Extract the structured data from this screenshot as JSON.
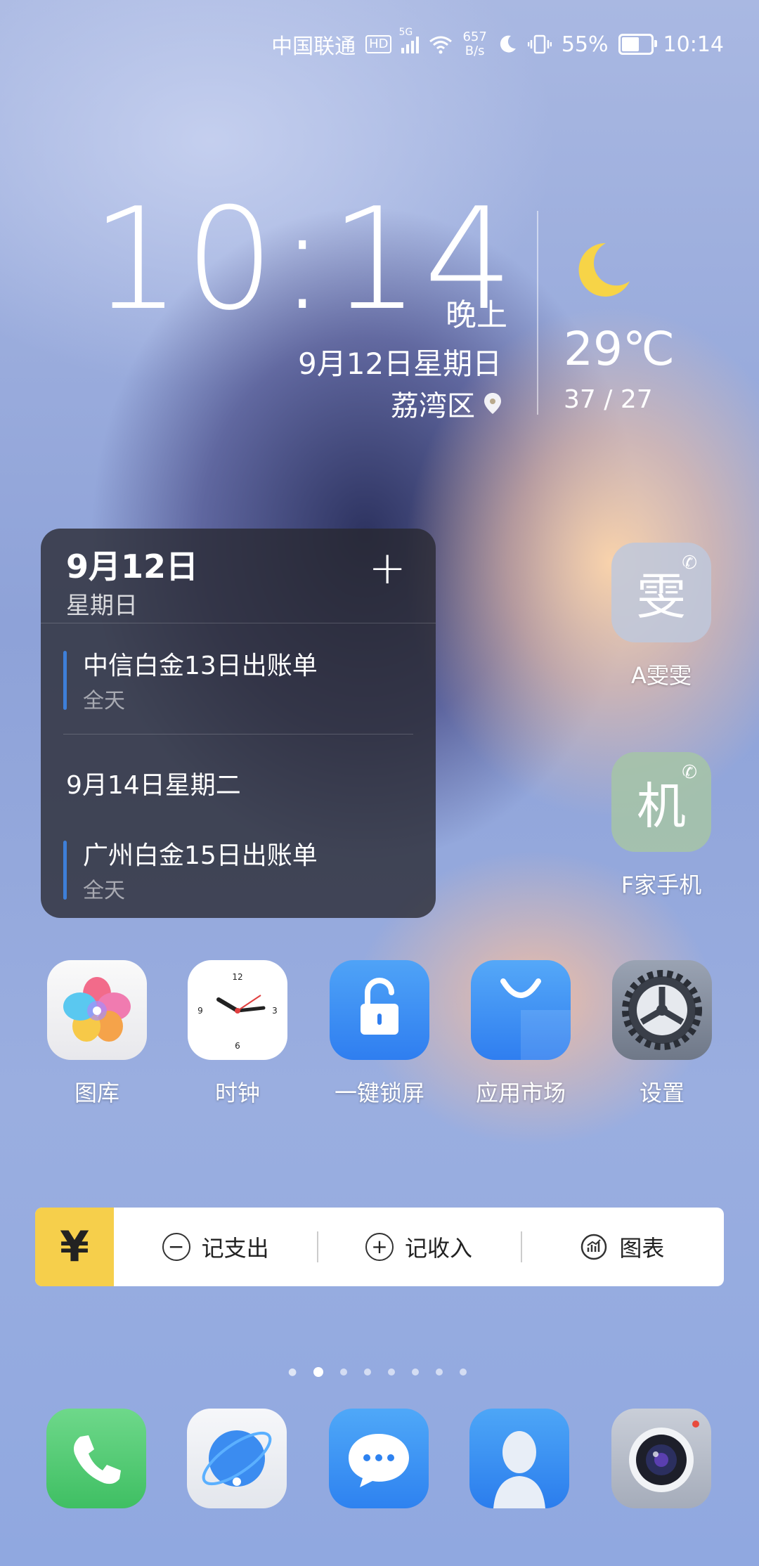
{
  "status_bar": {
    "carrier": "中国联通",
    "hd": "HD",
    "net": "5G",
    "speed_value": "657",
    "speed_unit": "B/s",
    "battery": "55%",
    "time": "10:14"
  },
  "clock_widget": {
    "time": "10:14",
    "ampm": "晚上",
    "date": "9月12日星期日",
    "location": "荔湾区",
    "temperature": "29℃",
    "range": "37 / 27"
  },
  "calendar": {
    "date": "9月12日",
    "weekday": "星期日",
    "add": "+",
    "events": [
      {
        "title": "中信白金13日出账单",
        "time": "全天"
      },
      {
        "title": "广州白金15日出账单",
        "time": "全天"
      }
    ],
    "next_date": "9月14日星期二"
  },
  "contacts": [
    {
      "glyph": "雯",
      "label": "A雯雯",
      "color": "#b9c3d6"
    },
    {
      "glyph": "机",
      "label": "F家手机",
      "color": "#a6c0a8"
    }
  ],
  "apps": [
    {
      "label": "图库"
    },
    {
      "label": "时钟"
    },
    {
      "label": "一键锁屏"
    },
    {
      "label": "应用市场"
    },
    {
      "label": "设置"
    }
  ],
  "clock_face": {
    "n12": "12",
    "n3": "3",
    "n6": "6",
    "n9": "9"
  },
  "money_widget": {
    "icon": "¥",
    "expense": "记支出",
    "income": "记收入",
    "chart": "图表",
    "minus": "−",
    "plus": "+"
  },
  "pages": {
    "count": 8,
    "current": 1
  },
  "dock": [
    {
      "icon": "phone-icon"
    },
    {
      "icon": "browser-icon"
    },
    {
      "icon": "messages-icon"
    },
    {
      "icon": "contacts-icon"
    },
    {
      "icon": "camera-icon"
    }
  ]
}
